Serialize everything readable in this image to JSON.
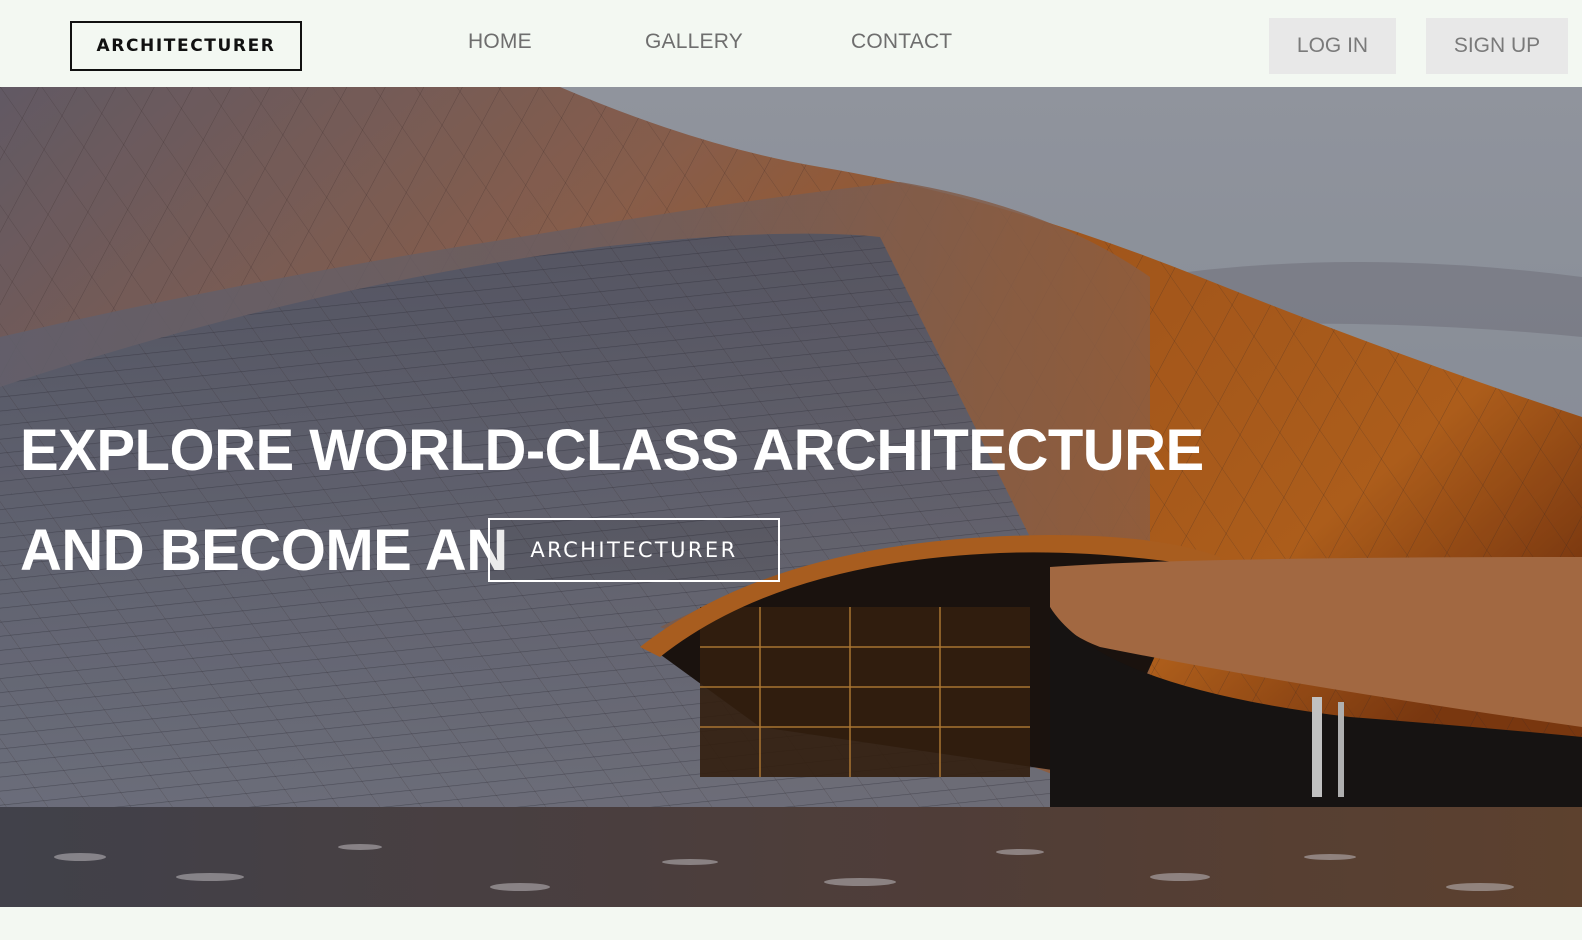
{
  "brand": {
    "logo_text": "ARCHITECTURER"
  },
  "nav": [
    {
      "label": "HOME"
    },
    {
      "label": "GALLERY"
    },
    {
      "label": "CONTACT"
    }
  ],
  "auth": {
    "login_label": "LOG IN",
    "signup_label": "SIGN UP"
  },
  "hero": {
    "line1": "EXPLORE WORLD-CLASS ARCHITECTURE",
    "line2": "AND BECOME AN",
    "badge": "ARCHITECTURER",
    "image": "curved-copper-building-photo"
  },
  "colors": {
    "page_bg": "#f3f8f2",
    "nav_text": "#6e6e6e",
    "auth_bg": "#e8e8e8",
    "hero_text": "#ffffff",
    "copper": "#b8621f"
  }
}
